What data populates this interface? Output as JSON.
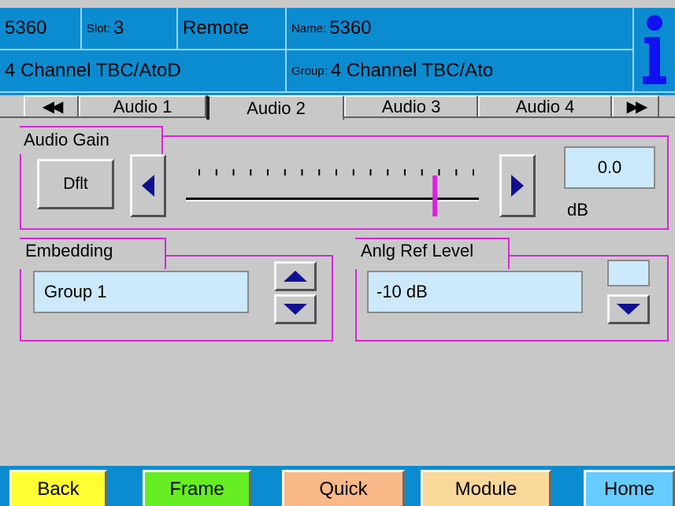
{
  "header": {
    "model": "5360",
    "slot_label": "Slot:",
    "slot_value": "3",
    "mode": "Remote",
    "name_label": "Name:",
    "name_value": "5360",
    "description": "4 Channel TBC/AtoD",
    "group_label": "Group:",
    "group_value": "4 Channel TBC/Ato",
    "info_icon": "info-icon"
  },
  "tabs": {
    "prev_icon": "double-left-arrow-icon",
    "next_icon": "double-right-arrow-icon",
    "items": [
      "Audio 1",
      "Audio 2",
      "Audio 3",
      "Audio 4"
    ],
    "active_index": 1
  },
  "audio_gain": {
    "title": "Audio Gain",
    "default_label": "Dflt",
    "value": "0.0",
    "unit": "dB",
    "slider_fraction": 0.85,
    "slider_marker_color": "#dd22dd"
  },
  "embedding": {
    "title": "Embedding",
    "value": "Group 1"
  },
  "anlg_ref_level": {
    "title": "Anlg Ref Level",
    "value": "-10 dB"
  },
  "bottom_nav": {
    "back": "Back",
    "frame": "Frame",
    "quick": "Quick",
    "module": "Module",
    "home": "Home"
  },
  "colors": {
    "header_blue": "#0b8cd0",
    "frame_magenta": "#d626d6",
    "value_box": "#cce9fb",
    "back_yellow": "#ffff33",
    "frame_green": "#66ee22",
    "quick_peach": "#f8b888",
    "module_tan": "#fad89a",
    "home_cyan": "#66ccff",
    "arrow_navy": "#101090"
  }
}
